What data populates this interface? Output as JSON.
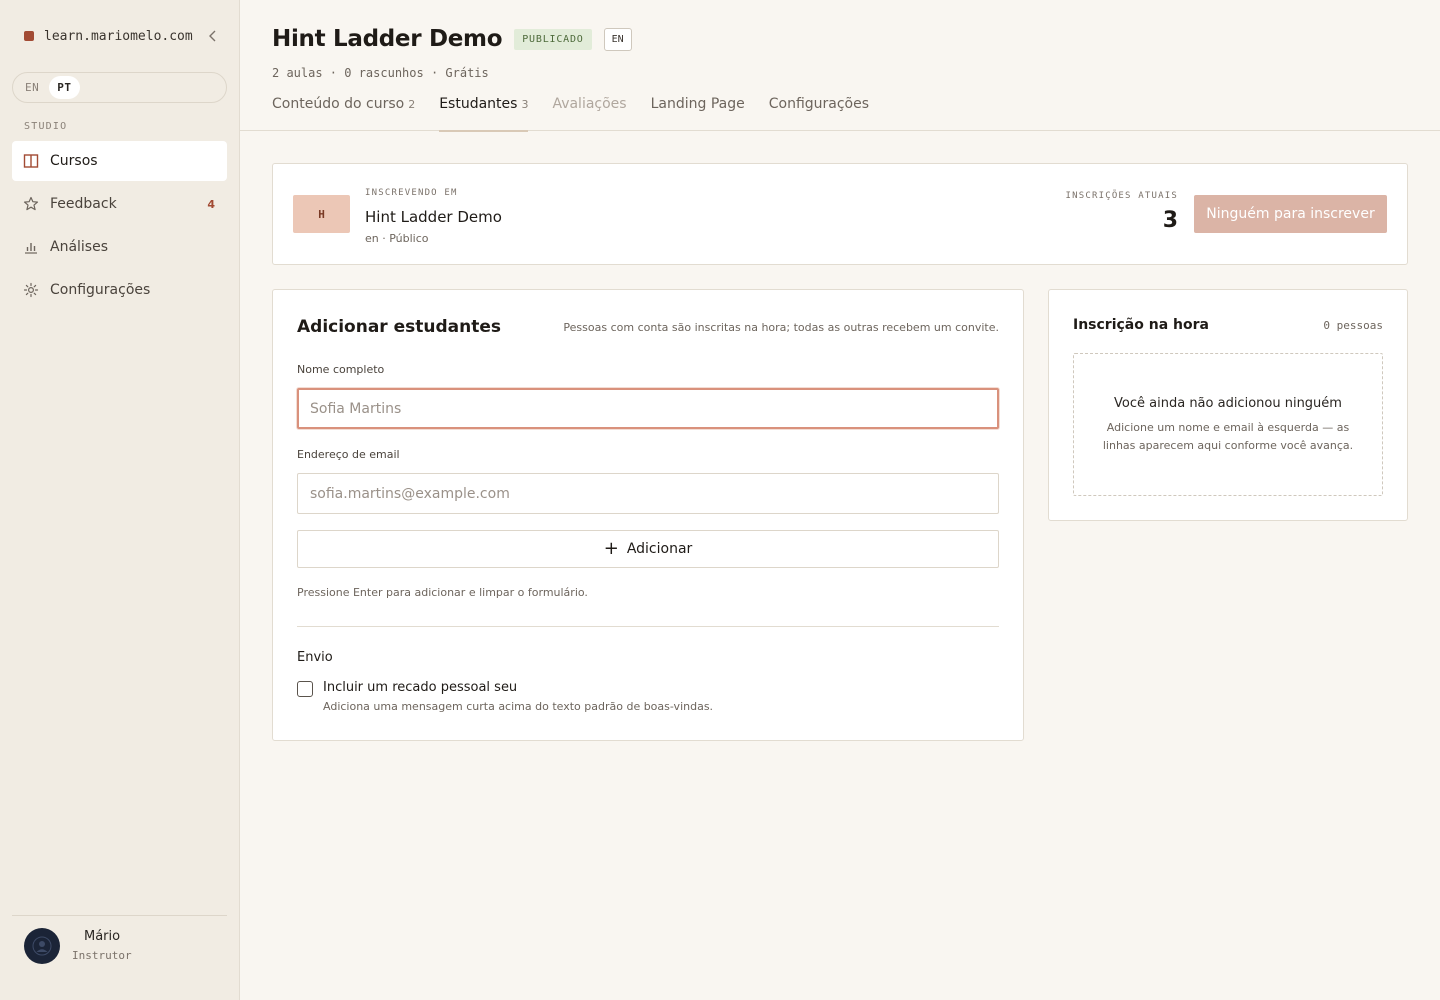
{
  "sidebar": {
    "site_name": "learn.mariomelo.com",
    "languages": [
      "EN",
      "PT"
    ],
    "active_language": "PT",
    "section_label": "STUDIO",
    "items": [
      {
        "label": "Cursos",
        "icon": "book-icon",
        "active": true
      },
      {
        "label": "Feedback",
        "icon": "star-icon",
        "badge": "4"
      },
      {
        "label": "Análises",
        "icon": "bar-chart-icon"
      },
      {
        "label": "Configurações",
        "icon": "gear-icon"
      }
    ],
    "user": {
      "name": "Mário",
      "role": "Instrutor"
    }
  },
  "header": {
    "title": "Hint Ladder Demo",
    "status_badge": "PUBLICADO",
    "language_badge": "EN",
    "meta": "2 aulas · 0 rascunhos · Grátis",
    "tabs": [
      {
        "label": "Conteúdo do curso",
        "count": "2"
      },
      {
        "label": "Estudantes",
        "count": "3",
        "active": true
      },
      {
        "label": "Avaliações",
        "disabled": true
      },
      {
        "label": "Landing Page"
      },
      {
        "label": "Configurações"
      }
    ]
  },
  "enroll": {
    "thumb_letter": "H",
    "label": "INSCREVENDO EM",
    "course": "Hint Ladder Demo",
    "sub": "en · Público",
    "current_label": "INSCRIÇÕES ATUAIS",
    "current_count": "3",
    "button": "Ninguém para inscrever"
  },
  "add_students": {
    "title": "Adicionar estudantes",
    "hint": "Pessoas com conta são inscritas na hora; todas as outras recebem um convite.",
    "name_label": "Nome completo",
    "name_placeholder": "Sofia Martins",
    "email_label": "Endereço de email",
    "email_placeholder": "sofia.martins@example.com",
    "add_button": "Adicionar",
    "enter_hint": "Pressione Enter para adicionar e limpar o formulário.",
    "send_label": "Envio",
    "personal_note_label": "Incluir um recado pessoal seu",
    "personal_note_sub": "Adiciona uma mensagem curta acima do texto padrão de boas-vindas."
  },
  "instant": {
    "title": "Inscrição na hora",
    "count": "0 pessoas",
    "empty_title": "Você ainda não adicionou ninguém",
    "empty_sub": "Adicione um nome e email à esquerda — as linhas aparecem aqui conforme você avança."
  }
}
